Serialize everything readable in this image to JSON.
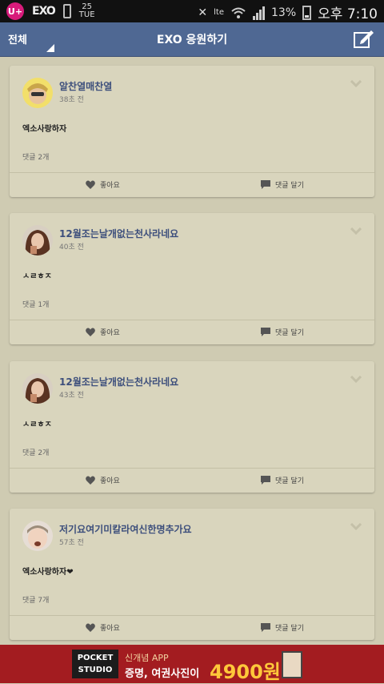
{
  "status_bar": {
    "carrier_badge": "U+",
    "app_logo": "EXO",
    "date_top": "25",
    "date_bottom": "TUE",
    "battery_percent": "13%",
    "time": "오후 7:10",
    "lte_label": "lte",
    "battery_level": 0.13
  },
  "header": {
    "filter_label": "전체",
    "title": "EXO 응원하기",
    "accent_color": "#4f6893"
  },
  "posts": [
    {
      "author": "알찬열매찬열",
      "time_ago": "38초 전",
      "content": "엑소사랑하자",
      "comment_count": "댓글 2개",
      "like_label": "좋아요",
      "reply_label": "댓글 달기"
    },
    {
      "author": "12월조는날개없는천사라네요",
      "time_ago": "40초 전",
      "content": "ㅅㄹㅎㅈ",
      "comment_count": "댓글 1개",
      "like_label": "좋아요",
      "reply_label": "댓글 달기"
    },
    {
      "author": "12월조는날개없는천사라네요",
      "time_ago": "43초 전",
      "content": "ㅅㄹㅎㅈ",
      "comment_count": "댓글 2개",
      "like_label": "좋아요",
      "reply_label": "댓글 달기"
    },
    {
      "author": "저기요여기미칼라여신한명추가요",
      "time_ago": "57초 전",
      "content": "엑소사랑하자❤",
      "comment_count": "댓글 7개",
      "like_label": "좋아요",
      "reply_label": "댓글 달기"
    }
  ],
  "ad": {
    "brand_line1": "POCKET",
    "brand_line2": "STUDIO",
    "tagline": "신개념 APP",
    "headline": "증명, 여권사진이",
    "price": "4900원"
  }
}
